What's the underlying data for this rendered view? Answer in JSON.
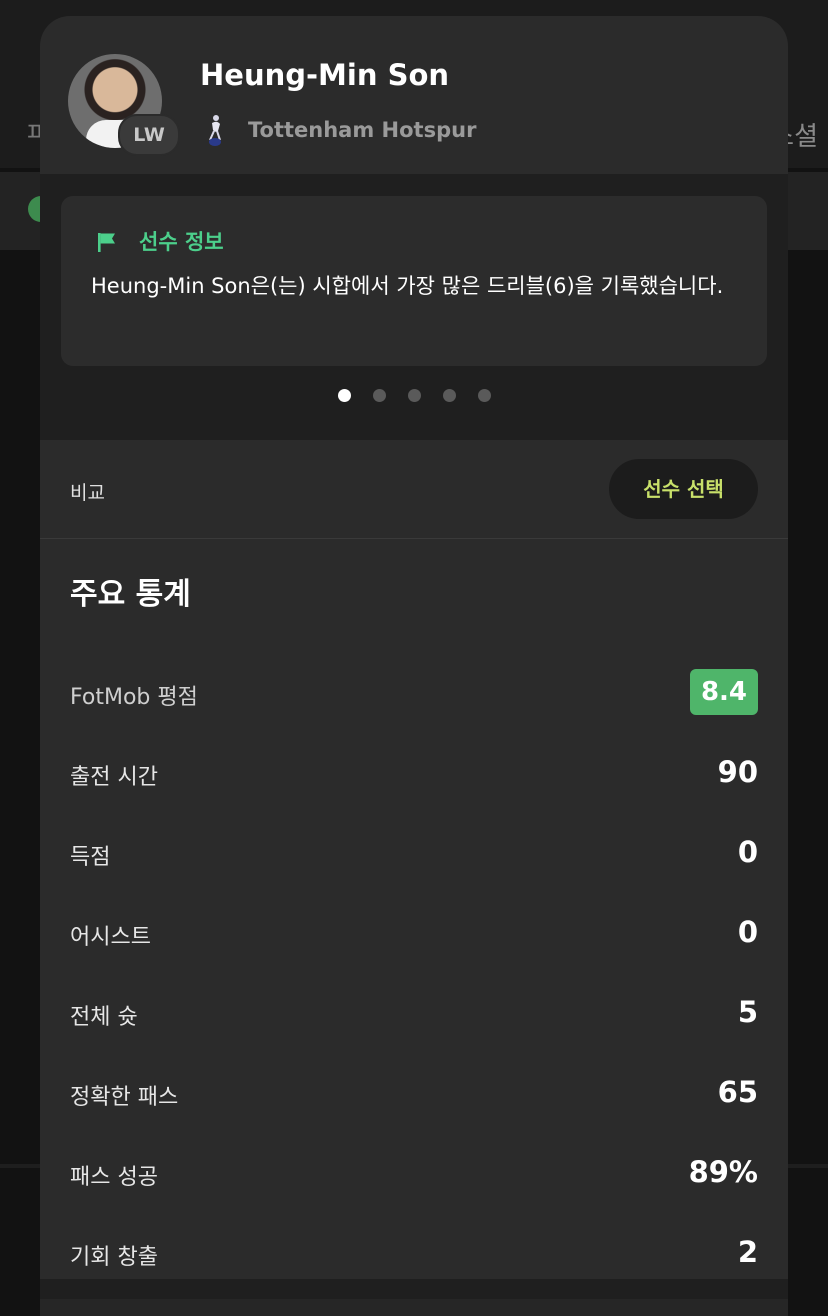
{
  "background": {
    "left_fragment": "ㅍ",
    "right_fragment": "소셜"
  },
  "player": {
    "name": "Heung-Min Son",
    "position": "LW",
    "club": "Tottenham Hotspur"
  },
  "info_card": {
    "title": "선수 정보",
    "text": "Heung-Min Son은(는) 시합에서 가장 많은 드리블(6)을 기록했습니다.",
    "page_count": 5,
    "active_page": 1
  },
  "compare": {
    "label": "비교",
    "button_label": "선수 선택"
  },
  "stats": {
    "title": "주요 통계",
    "rows": [
      {
        "label": "FotMob 평점",
        "value": "8.4"
      },
      {
        "label": "출전 시간",
        "value": "90"
      },
      {
        "label": "득점",
        "value": "0"
      },
      {
        "label": "어시스트",
        "value": "0"
      },
      {
        "label": "전체 슛",
        "value": "5"
      },
      {
        "label": "정확한 패스",
        "value": "65"
      },
      {
        "label": "패스 성공",
        "value": "89%"
      },
      {
        "label": "기회 창출",
        "value": "2"
      }
    ]
  },
  "colors": {
    "accent_green": "#4ccf8b",
    "rating_green": "#4fb56a",
    "button_text": "#c8e06a"
  }
}
